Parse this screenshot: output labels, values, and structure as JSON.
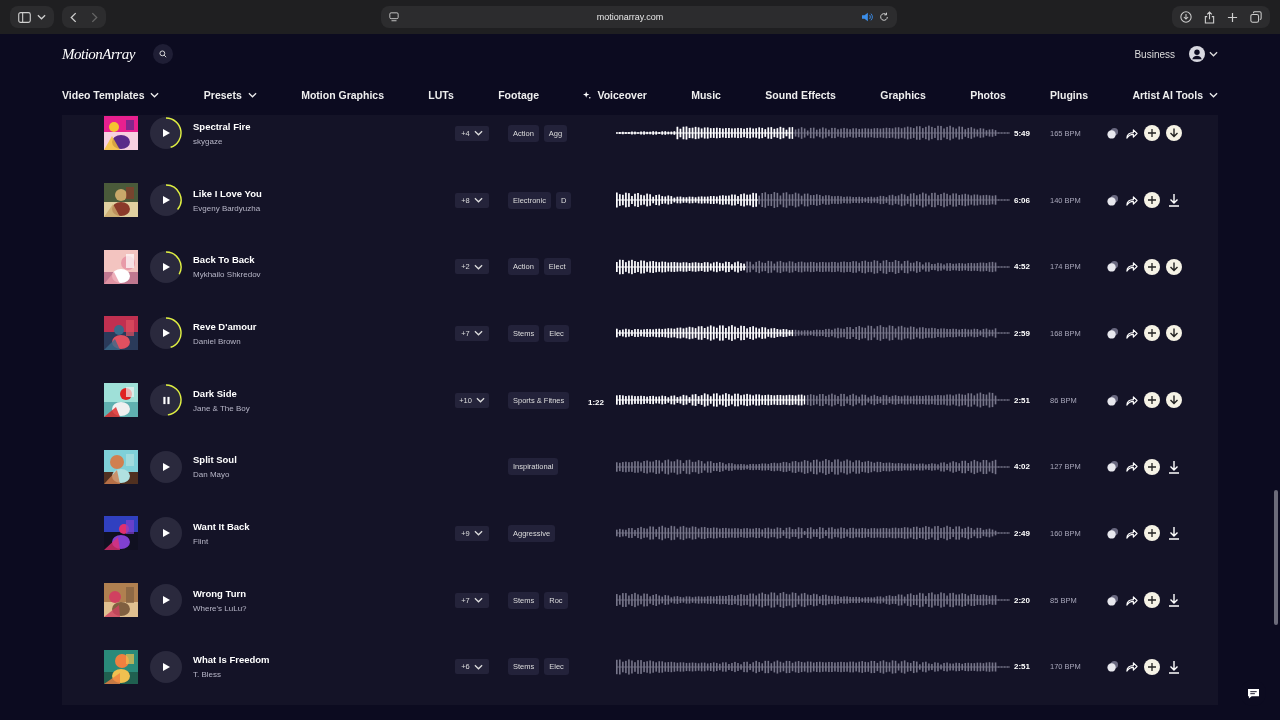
{
  "browser": {
    "url": "motionarray.com"
  },
  "header": {
    "logo": "MotionArray",
    "account_label": "Business"
  },
  "nav": [
    {
      "label": "Video Templates",
      "has_menu": true,
      "sparkle": false
    },
    {
      "label": "Presets",
      "has_menu": true,
      "sparkle": false
    },
    {
      "label": "Motion Graphics",
      "has_menu": false,
      "sparkle": false
    },
    {
      "label": "LUTs",
      "has_menu": false,
      "sparkle": false
    },
    {
      "label": "Footage",
      "has_menu": false,
      "sparkle": false
    },
    {
      "label": "Voiceover",
      "has_menu": false,
      "sparkle": true
    },
    {
      "label": "Music",
      "has_menu": false,
      "sparkle": false
    },
    {
      "label": "Sound Effects",
      "has_menu": false,
      "sparkle": false
    },
    {
      "label": "Graphics",
      "has_menu": false,
      "sparkle": false
    },
    {
      "label": "Photos",
      "has_menu": false,
      "sparkle": false
    },
    {
      "label": "Plugins",
      "has_menu": false,
      "sparkle": false
    },
    {
      "label": "Artist AI Tools",
      "has_menu": true,
      "sparkle": false
    }
  ],
  "rows": [
    {
      "title": "Spectral Fire",
      "artist": "skygaze",
      "more": "+4",
      "tags": [
        "Action",
        "Agg"
      ],
      "duration": "5:49",
      "bpm": "165 BPM",
      "playing": false,
      "level": 0.45,
      "download_filled": true
    },
    {
      "title": "Like I Love You",
      "artist": "Evgeny Bardyuzha",
      "more": "+8",
      "tags": [
        "Electronic",
        "D"
      ],
      "duration": "6:06",
      "bpm": "140 BPM",
      "playing": false,
      "level": 0.36,
      "download_filled": false
    },
    {
      "title": "Back To Back",
      "artist": "Mykhailo Shkredov",
      "more": "+2",
      "tags": [
        "Action",
        "Elect"
      ],
      "duration": "4:52",
      "bpm": "174 BPM",
      "playing": false,
      "level": 0.33,
      "download_filled": true
    },
    {
      "title": "Reve D'amour",
      "artist": "Daniel Brown",
      "more": "+7",
      "tags": [
        "Stems",
        "Elec"
      ],
      "duration": "2:59",
      "bpm": "168 BPM",
      "playing": false,
      "level": 0.45,
      "download_filled": true
    },
    {
      "title": "Dark Side",
      "artist": "Jane & The Boy",
      "more": "+10",
      "tags": [
        "Sports & Fitnes"
      ],
      "current_time": "1:22",
      "duration": "2:51",
      "bpm": "86 BPM",
      "playing": true,
      "level": 0.48,
      "download_filled": true
    },
    {
      "title": "Split Soul",
      "artist": "Dan Mayo",
      "tags": [
        "Inspirational"
      ],
      "duration": "4:02",
      "bpm": "127 BPM",
      "playing": false,
      "download_filled": false
    },
    {
      "title": "Want It Back",
      "artist": "Flint",
      "more": "+9",
      "tags": [
        "Aggressive"
      ],
      "duration": "2:49",
      "bpm": "160 BPM",
      "playing": false,
      "download_filled": false
    },
    {
      "title": "Wrong Turn",
      "artist": "Where's LuLu?",
      "more": "+7",
      "tags": [
        "Stems",
        "Roc"
      ],
      "duration": "2:20",
      "bpm": "85 BPM",
      "playing": false,
      "download_filled": false
    },
    {
      "title": "What Is Freedom",
      "artist": "T. Bless",
      "more": "+6",
      "tags": [
        "Stems",
        "Elec"
      ],
      "duration": "2:51",
      "bpm": "170 BPM",
      "playing": false,
      "download_filled": false
    }
  ]
}
